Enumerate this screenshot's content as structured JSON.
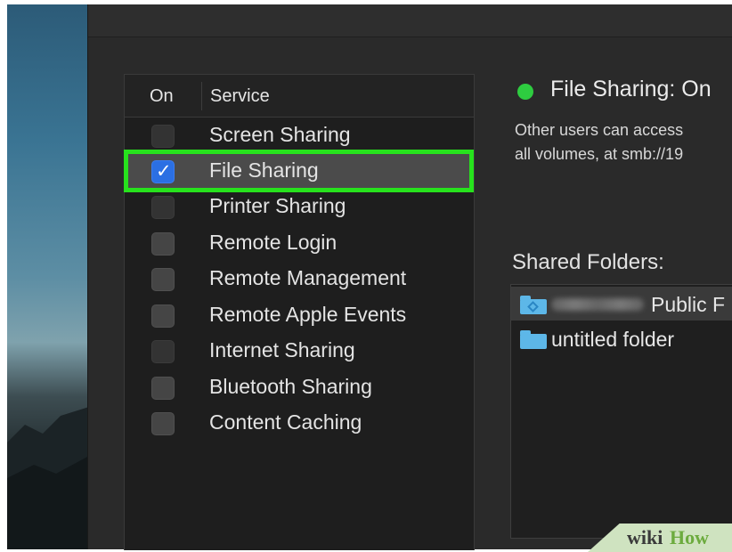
{
  "services_panel": {
    "col_on": "On",
    "col_service": "Service",
    "items": [
      {
        "label": "Screen Sharing",
        "checked": false
      },
      {
        "label": "File Sharing",
        "checked": true
      },
      {
        "label": "Printer Sharing",
        "checked": false
      },
      {
        "label": "Remote Login",
        "checked": false
      },
      {
        "label": "Remote Management",
        "checked": false
      },
      {
        "label": "Remote Apple Events",
        "checked": false
      },
      {
        "label": "Internet Sharing",
        "checked": false
      },
      {
        "label": "Bluetooth Sharing",
        "checked": false
      },
      {
        "label": "Content Caching",
        "checked": false
      }
    ]
  },
  "status": {
    "text": "File Sharing: On",
    "color": "#2ecc40",
    "description_line1": "Other users can access",
    "description_line2": "all volumes, at smb://19"
  },
  "shared_folders": {
    "title": "Shared Folders:",
    "folders": [
      {
        "label": "Public F",
        "icon": "public-folder-icon",
        "selected": true
      },
      {
        "label": "untitled folder",
        "icon": "folder-icon",
        "selected": false
      }
    ]
  },
  "watermark": {
    "wiki": "wiki",
    "how": "How"
  },
  "colors": {
    "highlight": "#27e21d",
    "checkbox_checked": "#2b6fe3",
    "folder": "#5db7e8"
  }
}
